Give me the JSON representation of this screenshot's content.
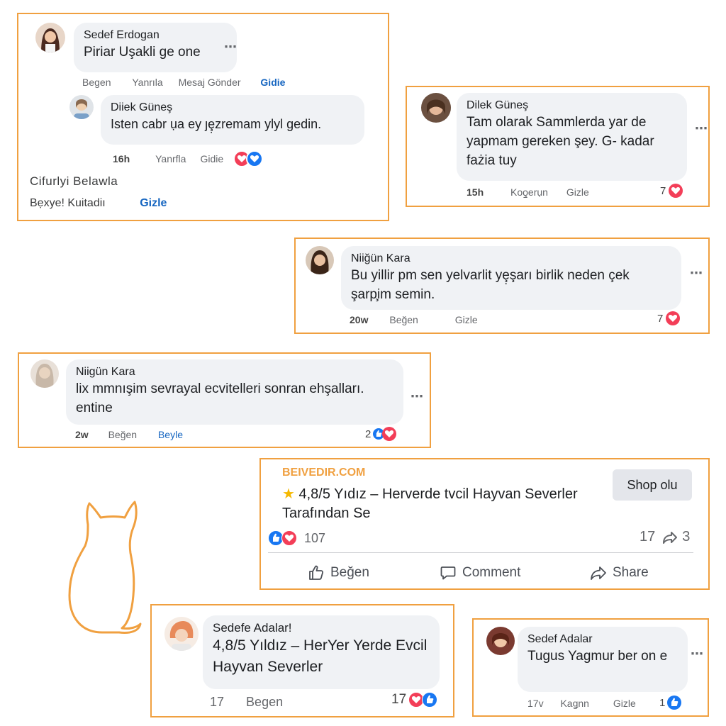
{
  "colors": {
    "border": "#f0a040",
    "heart": "#f33e58",
    "like": "#1877f2",
    "link": "#1565c0",
    "bubble": "#f0f2f5"
  },
  "card1": {
    "comment": {
      "author": "Sedef Erdogan",
      "text": "Piriar Uşakli ge one",
      "more": "⋯"
    },
    "actions": {
      "like": "Begen",
      "reply": "Yanrıla",
      "message": "Mesaj Gönder",
      "hide": "Gidie"
    },
    "reply": {
      "author": "Diiek Güneş",
      "text": "Isten cabr ụa ey ȷȩ̣zremam ylyl gedin."
    },
    "reply_meta": {
      "time": "16h",
      "reply": "Yanrfla",
      "hide": "Gidie"
    },
    "line1": "Cifurlyi Belawla",
    "line2": "Bẹxye! Kuitadiı",
    "line2_link": "Gizle"
  },
  "card2": {
    "author": "Dilek Güneş",
    "text": "Tam olarak Sammlerda yar de yapmam gereken şey. G- kadar fażia tuy",
    "more": "⋯",
    "time": "15h",
    "reply": "Koƍerụn",
    "hide": "Gizle",
    "reaction_count": "7"
  },
  "card3": {
    "author": "Niiğün Kara",
    "text": "Bu yillir pm sen yelvarlit yȩ̣şarı birlik neden çek şarp̧im semin.",
    "more": "⋯",
    "time": "20w",
    "like": "Beğen",
    "hide": "Gizle",
    "reaction_count": "7"
  },
  "card4": {
    "author": "Niigün Kara",
    "text": "lix mmnışim sevrayal ecvitelleri sonran ehşalları. entine",
    "more": "⋯",
    "time": "2w",
    "like": "Beğen",
    "reply": "Beyle",
    "reaction_count": "2"
  },
  "ad": {
    "domain": "BEIVEDIR.COM",
    "headline": "4,8/5 Yıdız – Herverde tvcil Hayvan Severler Tarafından Se",
    "star_icon": "star-icon",
    "button": "Shop olu",
    "reaction_count": "107",
    "comments_count": "17",
    "shares_count": "3",
    "actions": {
      "like": "Beğen",
      "comment": "Comment",
      "share": "Share"
    }
  },
  "card6": {
    "author": "Sedefe Adalar!",
    "text": "4,8/5 Yıldız – HerYer Yerde Evcil Hayvan Severler",
    "time": "17",
    "like": "Begen",
    "reaction_count": "17"
  },
  "card7": {
    "author": "Sedef Adalar",
    "text": "Tugus Yagmur ber on e",
    "more": "⋯",
    "time": "17v",
    "reply": "Kaǥnn",
    "hide": "Gizle",
    "reaction_count": "1"
  }
}
